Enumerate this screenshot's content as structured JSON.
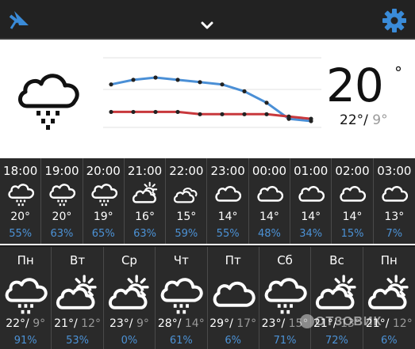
{
  "topbar": {
    "left_icon": "satellite-icon",
    "center_icon": "chevron-down-icon",
    "right_icon": "gear-icon",
    "accent": "#3a8bd8"
  },
  "current": {
    "icon": "rain-cloud-icon",
    "temp": "20",
    "deg": "°",
    "hi": "22°",
    "sep": "/",
    "lo": "9°"
  },
  "trend": {
    "upper": [
      24,
      26,
      27,
      26,
      25,
      24,
      21,
      16,
      9,
      8
    ],
    "lower": [
      12,
      12,
      12,
      12,
      11,
      11,
      11,
      11,
      10,
      9
    ],
    "colors": {
      "upper": "#4a8fd6",
      "lower": "#c8383c"
    }
  },
  "hourly": [
    {
      "time": "18:00",
      "icon": "rain-cloud-icon",
      "temp": "20°",
      "pct": "55%"
    },
    {
      "time": "19:00",
      "icon": "rain-cloud-icon",
      "temp": "20°",
      "pct": "63%"
    },
    {
      "time": "20:00",
      "icon": "rain-cloud-icon",
      "temp": "19°",
      "pct": "65%"
    },
    {
      "time": "21:00",
      "icon": "sun-cloud-icon",
      "temp": "16°",
      "pct": "63%"
    },
    {
      "time": "22:00",
      "icon": "clouds-icon",
      "temp": "15°",
      "pct": "59%"
    },
    {
      "time": "23:00",
      "icon": "cloud-icon",
      "temp": "14°",
      "pct": "55%"
    },
    {
      "time": "00:00",
      "icon": "cloud-icon",
      "temp": "14°",
      "pct": "48%"
    },
    {
      "time": "01:00",
      "icon": "cloud-icon",
      "temp": "14°",
      "pct": "34%"
    },
    {
      "time": "02:00",
      "icon": "cloud-icon",
      "temp": "14°",
      "pct": "15%"
    },
    {
      "time": "03:00",
      "icon": "cloud-icon",
      "temp": "13°",
      "pct": "7%"
    }
  ],
  "daily": [
    {
      "day": "Пн",
      "icon": "rain-cloud-icon",
      "hi": "22°",
      "sep": "/",
      "lo": "9°",
      "pct": "91%"
    },
    {
      "day": "Вт",
      "icon": "sun-cloud-icon",
      "hi": "21°",
      "sep": "/",
      "lo": "12°",
      "pct": "53%"
    },
    {
      "day": "Ср",
      "icon": "sun-cloud-icon",
      "hi": "23°",
      "sep": "/",
      "lo": "9°",
      "pct": "0%"
    },
    {
      "day": "Чт",
      "icon": "rain-cloud-icon",
      "hi": "28°",
      "sep": "/",
      "lo": "14°",
      "pct": "61%"
    },
    {
      "day": "Пт",
      "icon": "cloud-icon",
      "hi": "29°",
      "sep": "/",
      "lo": "17°",
      "pct": "6%"
    },
    {
      "day": "Сб",
      "icon": "rain-cloud-icon",
      "hi": "23°",
      "sep": "/",
      "lo": "15°",
      "pct": "71%"
    },
    {
      "day": "Вс",
      "icon": "sun-cloud-icon",
      "hi": "21°",
      "sep": "/",
      "lo": "13°",
      "pct": "72%"
    },
    {
      "day": "Пн",
      "icon": "sun-cloud-icon",
      "hi": "21°",
      "sep": "/",
      "lo": "12°",
      "pct": "6%"
    }
  ],
  "watermark": "ОТЗОВИК"
}
